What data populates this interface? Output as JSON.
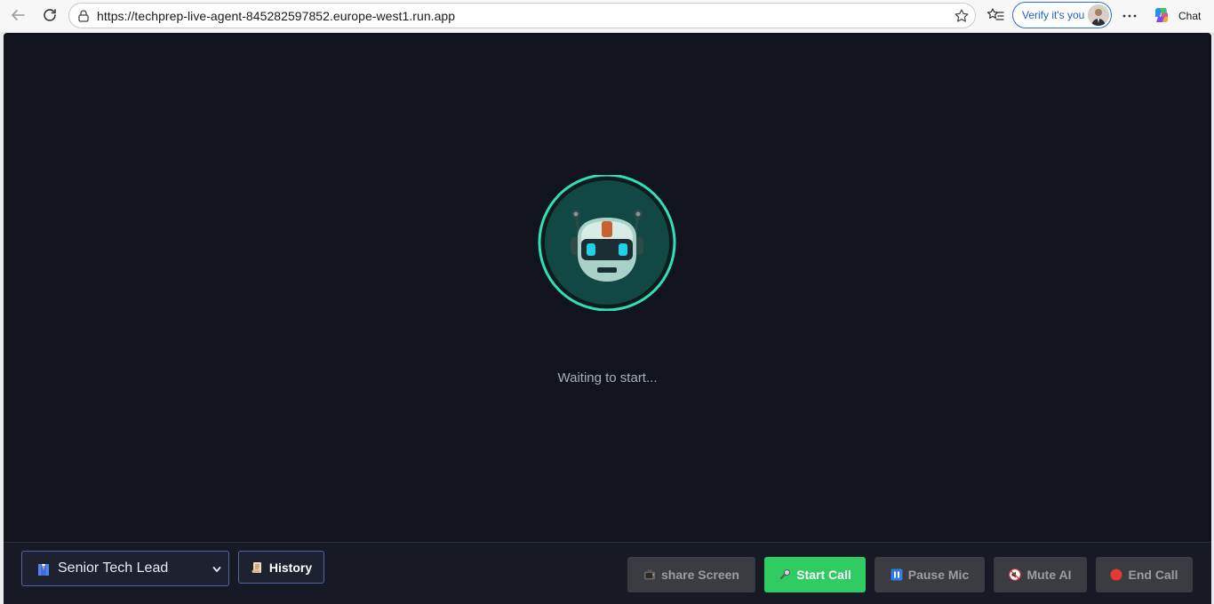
{
  "browser": {
    "url": "https://techprep-live-agent-845282597852.europe-west1.run.app",
    "verify_label": "Verify it's you",
    "chat_label": "Chat"
  },
  "app": {
    "status_text": "Waiting to start...",
    "persona_select": {
      "selected": "Senior Tech Lead",
      "icon": "person-in-suit-icon"
    },
    "history_button": {
      "label": "History",
      "icon": "scroll-icon"
    },
    "controls": {
      "share_screen": {
        "label": "share Screen",
        "icon": "tv-icon"
      },
      "start_call": {
        "label": "Start Call",
        "icon": "microphone-icon"
      },
      "pause_mic": {
        "label": "Pause Mic",
        "icon": "pause-icon"
      },
      "mute_ai": {
        "label": "Mute AI",
        "icon": "muted-speaker-icon"
      },
      "end_call": {
        "label": "End Call",
        "icon": "red-circle-icon"
      }
    },
    "colors": {
      "background": "#12141d",
      "accent_ring": "#2ee0b8",
      "start_green": "#2ecc63",
      "disabled_gray": "#3a3c41"
    }
  }
}
